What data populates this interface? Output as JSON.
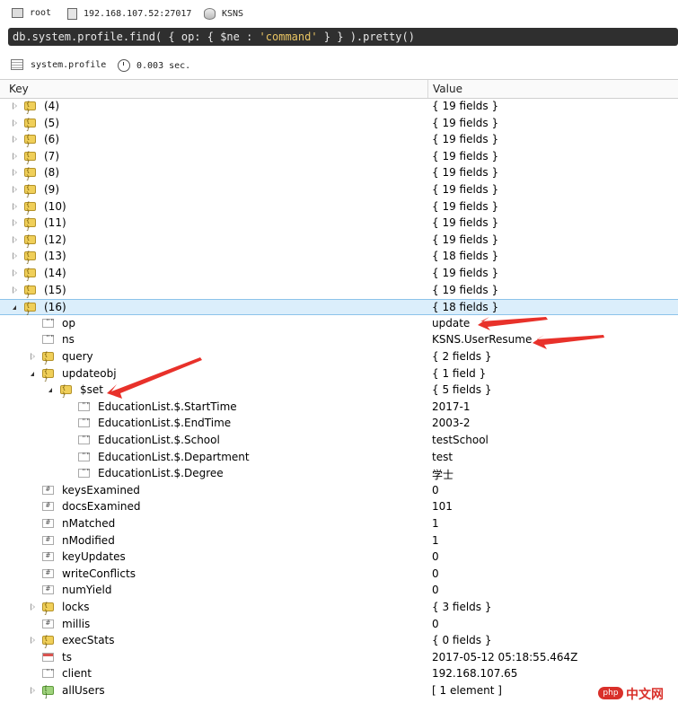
{
  "connection": {
    "user": "root",
    "server": "192.168.107.52:27017",
    "database": "KSNS"
  },
  "query": {
    "prefix": "db.system.profile.find( { op: { $ne : ",
    "string": "'command'",
    "suffix": " } } ).pretty()"
  },
  "status": {
    "collection": "system.profile",
    "time": "0.003 sec."
  },
  "columns": {
    "key": "Key",
    "value": "Value"
  },
  "rows": [
    {
      "key": "(4)",
      "value": "{ 19 fields }",
      "type": "obj",
      "level": 0,
      "expand": "closed"
    },
    {
      "key": "(5)",
      "value": "{ 19 fields }",
      "type": "obj",
      "level": 0,
      "expand": "closed"
    },
    {
      "key": "(6)",
      "value": "{ 19 fields }",
      "type": "obj",
      "level": 0,
      "expand": "closed"
    },
    {
      "key": "(7)",
      "value": "{ 19 fields }",
      "type": "obj",
      "level": 0,
      "expand": "closed"
    },
    {
      "key": "(8)",
      "value": "{ 19 fields }",
      "type": "obj",
      "level": 0,
      "expand": "closed"
    },
    {
      "key": "(9)",
      "value": "{ 19 fields }",
      "type": "obj",
      "level": 0,
      "expand": "closed"
    },
    {
      "key": "(10)",
      "value": "{ 19 fields }",
      "type": "obj",
      "level": 0,
      "expand": "closed"
    },
    {
      "key": "(11)",
      "value": "{ 19 fields }",
      "type": "obj",
      "level": 0,
      "expand": "closed"
    },
    {
      "key": "(12)",
      "value": "{ 19 fields }",
      "type": "obj",
      "level": 0,
      "expand": "closed"
    },
    {
      "key": "(13)",
      "value": "{ 18 fields }",
      "type": "obj",
      "level": 0,
      "expand": "closed"
    },
    {
      "key": "(14)",
      "value": "{ 19 fields }",
      "type": "obj",
      "level": 0,
      "expand": "closed"
    },
    {
      "key": "(15)",
      "value": "{ 19 fields }",
      "type": "obj",
      "level": 0,
      "expand": "closed"
    },
    {
      "key": "(16)",
      "value": "{ 18 fields }",
      "type": "obj",
      "level": 0,
      "expand": "open",
      "selected": true
    },
    {
      "key": "op",
      "value": "update",
      "type": "str",
      "level": 1,
      "expand": "none"
    },
    {
      "key": "ns",
      "value": "KSNS.UserResume",
      "type": "str",
      "level": 1,
      "expand": "none"
    },
    {
      "key": "query",
      "value": "{ 2 fields }",
      "type": "obj",
      "level": 1,
      "expand": "closed"
    },
    {
      "key": "updateobj",
      "value": "{ 1 field }",
      "type": "obj",
      "level": 1,
      "expand": "open"
    },
    {
      "key": "$set",
      "value": "{ 5 fields }",
      "type": "obj",
      "level": 2,
      "expand": "open"
    },
    {
      "key": "EducationList.$.StartTime",
      "value": "2017-1",
      "type": "str",
      "level": 3,
      "expand": "none"
    },
    {
      "key": "EducationList.$.EndTime",
      "value": "2003-2",
      "type": "str",
      "level": 3,
      "expand": "none"
    },
    {
      "key": "EducationList.$.School",
      "value": "testSchool",
      "type": "str",
      "level": 3,
      "expand": "none"
    },
    {
      "key": "EducationList.$.Department",
      "value": "test",
      "type": "str",
      "level": 3,
      "expand": "none"
    },
    {
      "key": "EducationList.$.Degree",
      "value": "学士",
      "type": "str",
      "level": 3,
      "expand": "none"
    },
    {
      "key": "keysExamined",
      "value": "0",
      "type": "num",
      "level": 1,
      "expand": "none"
    },
    {
      "key": "docsExamined",
      "value": "101",
      "type": "num",
      "level": 1,
      "expand": "none"
    },
    {
      "key": "nMatched",
      "value": "1",
      "type": "num",
      "level": 1,
      "expand": "none"
    },
    {
      "key": "nModified",
      "value": "1",
      "type": "num",
      "level": 1,
      "expand": "none"
    },
    {
      "key": "keyUpdates",
      "value": "0",
      "type": "num",
      "level": 1,
      "expand": "none"
    },
    {
      "key": "writeConflicts",
      "value": "0",
      "type": "num",
      "level": 1,
      "expand": "none"
    },
    {
      "key": "numYield",
      "value": "0",
      "type": "num",
      "level": 1,
      "expand": "none"
    },
    {
      "key": "locks",
      "value": "{ 3 fields }",
      "type": "obj",
      "level": 1,
      "expand": "closed"
    },
    {
      "key": "millis",
      "value": "0",
      "type": "num",
      "level": 1,
      "expand": "none"
    },
    {
      "key": "execStats",
      "value": "{ 0 fields }",
      "type": "obj",
      "level": 1,
      "expand": "closed"
    },
    {
      "key": "ts",
      "value": "2017-05-12 05:18:55.464Z",
      "type": "date",
      "level": 1,
      "expand": "none"
    },
    {
      "key": "client",
      "value": "192.168.107.65",
      "type": "str",
      "level": 1,
      "expand": "none"
    },
    {
      "key": "allUsers",
      "value": "[ 1 element ]",
      "type": "arr",
      "level": 1,
      "expand": "closed"
    }
  ],
  "watermark": {
    "logo": "php",
    "text": "中文网"
  },
  "accent": {
    "annotation": "#e8312a",
    "selection": "#dbeefb",
    "query_bg": "#2f2f2f"
  }
}
